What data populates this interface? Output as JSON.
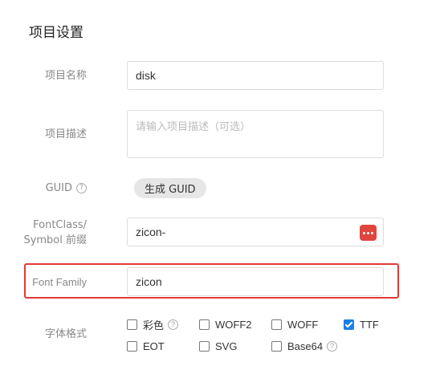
{
  "section_title": "项目设置",
  "fields": {
    "name": {
      "label": "项目名称",
      "value": "disk"
    },
    "description": {
      "label": "项目描述",
      "placeholder": "请输入项目描述（可选）"
    },
    "guid": {
      "label": "GUID",
      "help": "?",
      "button_label": "生成 GUID"
    },
    "fontclass": {
      "label_line1": "FontClass/",
      "label_line2": "Symbol 前缀",
      "value": "zicon-"
    },
    "font_family": {
      "label": "Font Family",
      "value": "zicon"
    },
    "font_format": {
      "label": "字体格式"
    }
  },
  "formats": [
    {
      "label": "彩色",
      "checked": false,
      "help": "?"
    },
    {
      "label": "WOFF2",
      "checked": false
    },
    {
      "label": "WOFF",
      "checked": false
    },
    {
      "label": "TTF",
      "checked": true
    },
    {
      "label": "EOT",
      "checked": false
    },
    {
      "label": "SVG",
      "checked": false
    },
    {
      "label": "Base64",
      "checked": false,
      "help": "?"
    }
  ],
  "colors": {
    "highlight": "#e53935",
    "checkbox_checked": "#1a7ee8",
    "dots_button": "#e0443e"
  }
}
